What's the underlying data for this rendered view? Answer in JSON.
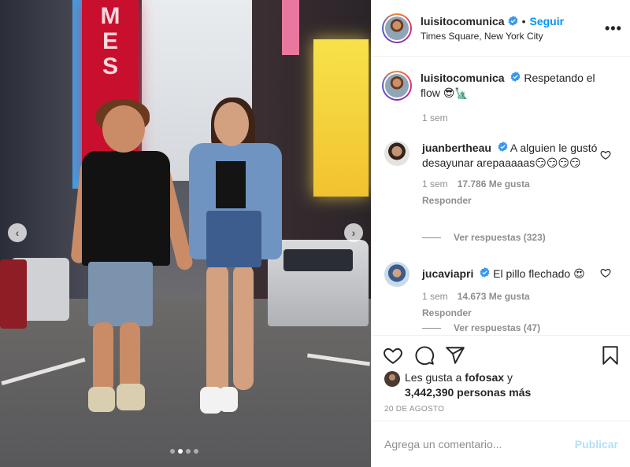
{
  "header": {
    "username": "luisitocomunica",
    "separator": "•",
    "follow_label": "Seguir",
    "location": "Times Square, New York City",
    "more_label": "•••"
  },
  "photo": {
    "sign_text": [
      "M",
      "E",
      "S"
    ],
    "prev_label": "‹",
    "next_label": "›",
    "carousel_total": 4,
    "carousel_active": 2
  },
  "caption": {
    "username": "luisitocomunica",
    "text": "Respetando el flow 😎🗽",
    "time": "1 sem"
  },
  "comments": [
    {
      "username": "juanbertheau",
      "text": "A alguien le gustó desayunar arepaaaaas😏😏😏😏",
      "time": "1 sem",
      "likes": "17.786 Me gusta",
      "reply": "Responder",
      "view_replies": "Ver respuestas (323)"
    },
    {
      "username": "jucaviapri",
      "text": "El pillo flechado 😍",
      "time": "1 sem",
      "likes": "14.673 Me gusta",
      "reply": "Responder",
      "view_replies": "Ver respuestas (47)"
    }
  ],
  "likes": {
    "prefix": "Les gusta a ",
    "user": "fofosax",
    "mid": " y",
    "count": "3,442,390 personas más"
  },
  "date": "20 DE AGOSTO",
  "add_comment": {
    "placeholder": "Agrega un comentario...",
    "publish_label": "Publicar"
  },
  "colors": {
    "accent": "#0095f6",
    "verified": "#3897f0",
    "publish_disabled": "#b2dffc"
  },
  "icons": [
    "heart-icon",
    "comment-icon",
    "share-icon",
    "bookmark-icon",
    "verified-icon",
    "more-icon"
  ]
}
